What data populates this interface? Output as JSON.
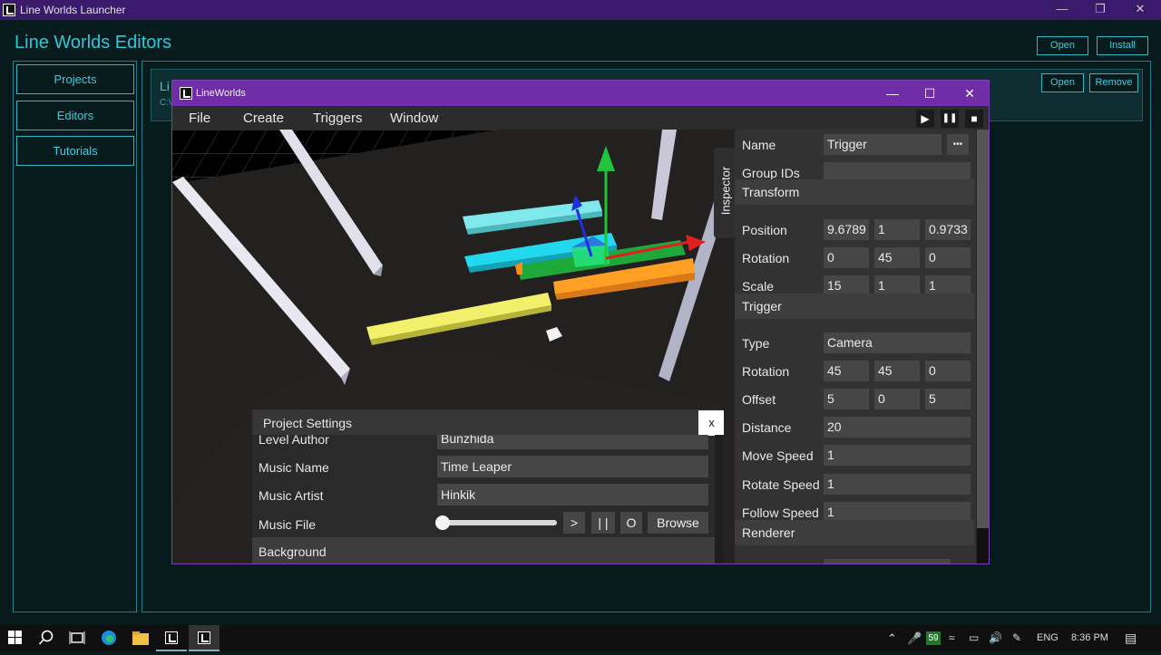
{
  "launcher": {
    "title": "Line Worlds Launcher",
    "heading": "Line Worlds Editors",
    "top_buttons": {
      "open": "Open",
      "install": "Install"
    },
    "nav": [
      "Projects",
      "Editors",
      "Tutorials"
    ],
    "project_card": {
      "name_partial": "Li",
      "path_partial": "C:\\",
      "open": "Open",
      "remove": "Remove"
    },
    "window_controls": {
      "minimize": "—",
      "restore": "❐",
      "close": "✕"
    }
  },
  "editor": {
    "title": "LineWorlds",
    "menu": [
      "File",
      "Create",
      "Triggers",
      "Window"
    ],
    "playback": {
      "play": "▶",
      "pause": "❚❚",
      "stop": "■"
    },
    "window_controls": {
      "minimize": "—",
      "maximize": "☐",
      "close": "✕"
    },
    "inspector": {
      "tab": "Inspector",
      "name_label": "Name",
      "name_value": "Trigger",
      "more": "•••",
      "group_ids_label": "Group IDs",
      "group_ids_value": "",
      "transform_header": "Transform",
      "position_label": "Position",
      "position": [
        "9.6789",
        "1",
        "0.9733"
      ],
      "rotation_label": "Rotation",
      "rotation": [
        "0",
        "45",
        "0"
      ],
      "scale_label": "Scale",
      "scale": [
        "15",
        "1",
        "1"
      ],
      "trigger_header": "Trigger",
      "type_label": "Type",
      "type_value": "Camera",
      "trig_rotation_label": "Rotation",
      "trig_rotation": [
        "45",
        "45",
        "0"
      ],
      "offset_label": "Offset",
      "offset": [
        "5",
        "0",
        "5"
      ],
      "distance_label": "Distance",
      "distance_value": "20",
      "move_speed_label": "Move Speed",
      "move_speed_value": "1",
      "rotate_speed_label": "Rotate Speed",
      "rotate_speed_value": "1",
      "follow_speed_label": "Follow Speed",
      "follow_speed_value": "1",
      "renderer_header": "Renderer"
    },
    "project_settings": {
      "title": "Project Settings",
      "close": "x",
      "level_author_label": "Level Author",
      "level_author_value": "Bunzhida",
      "music_name_label": "Music Name",
      "music_name_value": "Time Leaper",
      "music_artist_label": "Music Artist",
      "music_artist_value": "Hinkik",
      "music_file_label": "Music File",
      "music_progress": 0,
      "buttons": {
        "play": ">",
        "pause": "| |",
        "stop": "O",
        "browse": "Browse"
      },
      "background_label": "Background"
    }
  },
  "taskbar": {
    "tray": {
      "badge": "59",
      "language": "ENG",
      "time": "8:36 PM"
    }
  }
}
